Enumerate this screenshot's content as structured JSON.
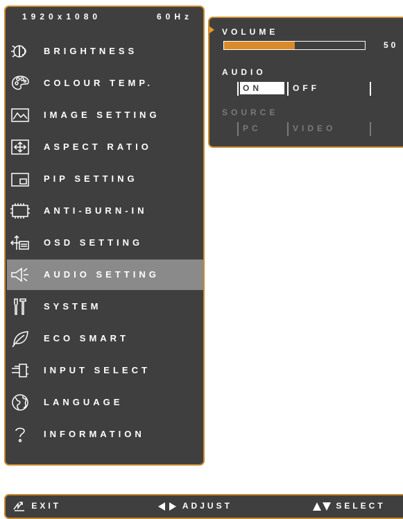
{
  "header": {
    "resolution": "1920x1080",
    "refresh": "60Hz"
  },
  "menu": {
    "items": [
      {
        "label": "BRIGHTNESS",
        "icon": "brightness-icon"
      },
      {
        "label": "COLOUR TEMP.",
        "icon": "palette-icon"
      },
      {
        "label": "IMAGE SETTING",
        "icon": "image-icon"
      },
      {
        "label": "ASPECT RATIO",
        "icon": "aspect-icon"
      },
      {
        "label": "PIP SETTING",
        "icon": "pip-icon"
      },
      {
        "label": "ANTI-BURN-IN",
        "icon": "chip-icon"
      },
      {
        "label": "OSD SETTING",
        "icon": "osd-icon"
      },
      {
        "label": "AUDIO SETTING",
        "icon": "speaker-icon",
        "selected": true
      },
      {
        "label": "SYSTEM",
        "icon": "tools-icon"
      },
      {
        "label": "ECO SMART",
        "icon": "leaf-icon"
      },
      {
        "label": "INPUT SELECT",
        "icon": "input-icon"
      },
      {
        "label": "LANGUAGE",
        "icon": "globe-icon"
      },
      {
        "label": "INFORMATION",
        "icon": "question-icon"
      }
    ]
  },
  "audio": {
    "volume_label": "VOLUME",
    "volume_value": "50",
    "volume_level": 0.5,
    "audio_label": "AUDIO",
    "audio_on": "ON",
    "audio_off": "OFF",
    "audio_selected": "ON",
    "source_label": "SOURCE",
    "source_pc": "PC",
    "source_video": "VIDEO"
  },
  "footer": {
    "exit": "EXIT",
    "adjust": "ADJUST",
    "select": "SELECT"
  },
  "colors": {
    "accent": "#c98a2c",
    "panel": "#3f3f3f",
    "highlight": "#8a8a8a",
    "bar_fill": "#d98a2b"
  }
}
